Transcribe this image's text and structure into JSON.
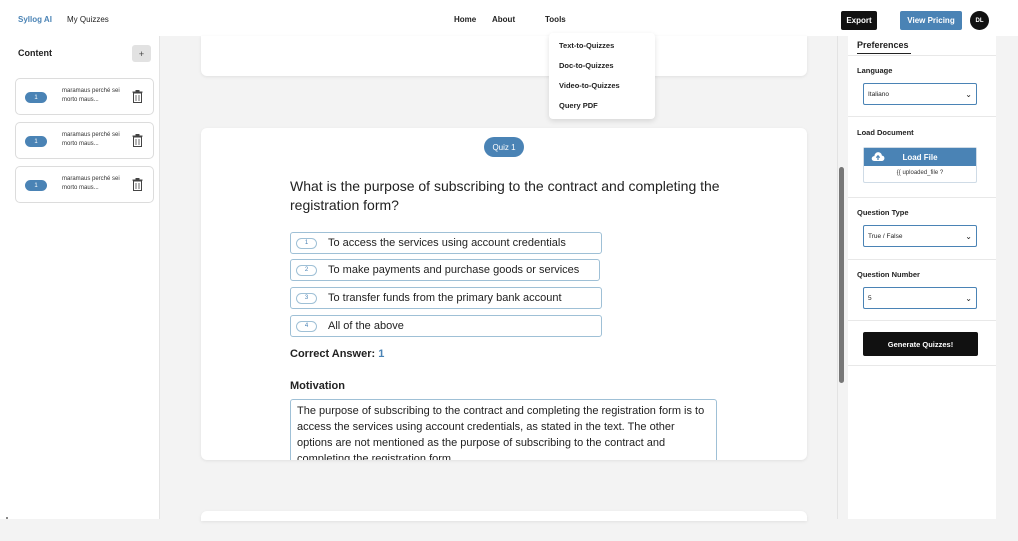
{
  "nav": {
    "brand": "Syllog AI",
    "my_quizzes": "My Quizzes",
    "home": "Home",
    "about": "About",
    "tools": "Tools",
    "export": "Export",
    "view_pricing": "View Pricing",
    "avatar_initials": "DL"
  },
  "tools_menu": {
    "items": [
      "Text-to-Quizzes",
      "Doc-to-Quizzes",
      "Video-to-Quizzes",
      "Query PDF"
    ]
  },
  "sidebar": {
    "title": "Content",
    "add_label": "+",
    "items": [
      {
        "badge": "1",
        "text": "maramaus perché sei morto maus..."
      },
      {
        "badge": "1",
        "text": "maramaus perché sei morto maus..."
      },
      {
        "badge": "1",
        "text": "maramaus perché sei morto maus..."
      }
    ]
  },
  "quiz": {
    "pill": "Quiz 1",
    "question": "What is the purpose of subscribing to the contract and completing the registration form?",
    "options": [
      {
        "num": "1",
        "text": "To access the services using account credentials"
      },
      {
        "num": "2",
        "text": "To make payments and purchase goods or services"
      },
      {
        "num": "3",
        "text": "To transfer funds from the primary bank account"
      },
      {
        "num": "4",
        "text": "All of the above"
      }
    ],
    "correct_label": "Correct Answer: ",
    "correct_value": "1",
    "motivation_title": "Motivation",
    "motivation_text": "The purpose of subscribing to the contract and completing the registration form is to access the services using account credentials, as stated in the text. The other options are not mentioned as the purpose of subscribing to the contract and completing the registration form."
  },
  "preferences": {
    "tab": "Preferences",
    "language_label": "Language",
    "language_value": "Italiano",
    "load_document_label": "Load Document",
    "load_file": "Load File",
    "uploaded_file": "{{ uploaded_file ?",
    "question_type_label": "Question Type",
    "question_type_value": "True / False",
    "question_number_label": "Question Number",
    "question_number_value": "5",
    "generate": "Generate Quizzes!"
  },
  "colors": {
    "accent": "#4a83b5",
    "dark": "#111111",
    "option_border": "#9fc0d6"
  }
}
